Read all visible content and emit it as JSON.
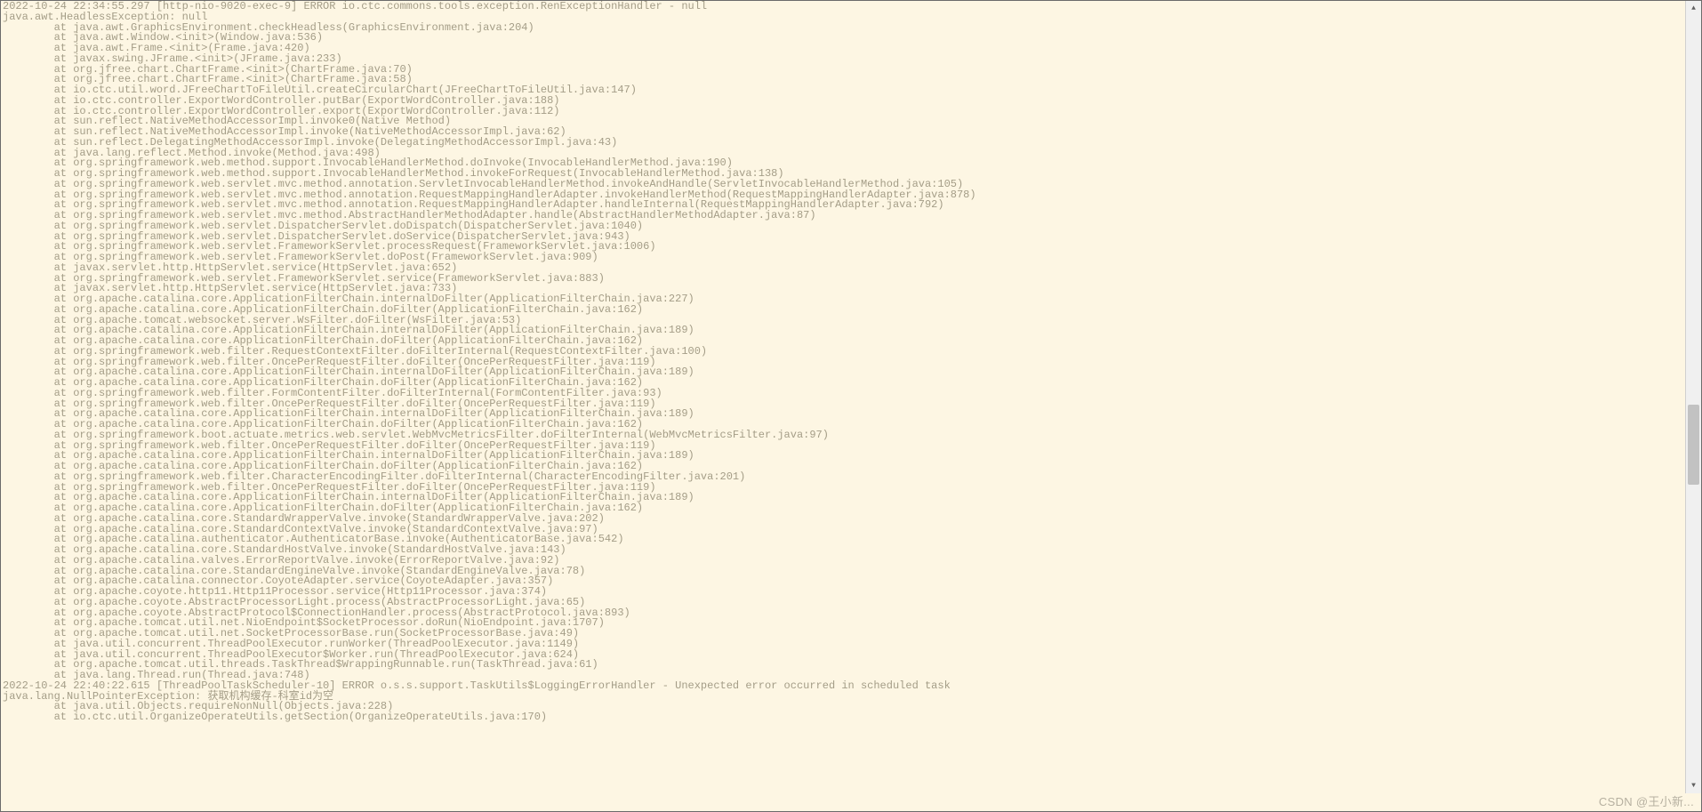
{
  "watermark": "CSDN @王小新...",
  "indent1": "        ",
  "lines": [
    "2022-10-24 22:34:55.297 [http-nio-9020-exec-9] ERROR io.ctc.commons.tools.exception.RenExceptionHandler - null",
    "java.awt.HeadlessException: null",
    "at java.awt.GraphicsEnvironment.checkHeadless(GraphicsEnvironment.java:204)",
    "at java.awt.Window.<init>(Window.java:536)",
    "at java.awt.Frame.<init>(Frame.java:420)",
    "at javax.swing.JFrame.<init>(JFrame.java:233)",
    "at org.jfree.chart.ChartFrame.<init>(ChartFrame.java:70)",
    "at org.jfree.chart.ChartFrame.<init>(ChartFrame.java:58)",
    "at io.ctc.util.word.JFreeChartToFileUtil.createCircularChart(JFreeChartToFileUtil.java:147)",
    "at io.ctc.controller.ExportWordController.putBar(ExportWordController.java:188)",
    "at io.ctc.controller.ExportWordController.export(ExportWordController.java:112)",
    "at sun.reflect.NativeMethodAccessorImpl.invoke0(Native Method)",
    "at sun.reflect.NativeMethodAccessorImpl.invoke(NativeMethodAccessorImpl.java:62)",
    "at sun.reflect.DelegatingMethodAccessorImpl.invoke(DelegatingMethodAccessorImpl.java:43)",
    "at java.lang.reflect.Method.invoke(Method.java:498)",
    "at org.springframework.web.method.support.InvocableHandlerMethod.doInvoke(InvocableHandlerMethod.java:190)",
    "at org.springframework.web.method.support.InvocableHandlerMethod.invokeForRequest(InvocableHandlerMethod.java:138)",
    "at org.springframework.web.servlet.mvc.method.annotation.ServletInvocableHandlerMethod.invokeAndHandle(ServletInvocableHandlerMethod.java:105)",
    "at org.springframework.web.servlet.mvc.method.annotation.RequestMappingHandlerAdapter.invokeHandlerMethod(RequestMappingHandlerAdapter.java:878)",
    "at org.springframework.web.servlet.mvc.method.annotation.RequestMappingHandlerAdapter.handleInternal(RequestMappingHandlerAdapter.java:792)",
    "at org.springframework.web.servlet.mvc.method.AbstractHandlerMethodAdapter.handle(AbstractHandlerMethodAdapter.java:87)",
    "at org.springframework.web.servlet.DispatcherServlet.doDispatch(DispatcherServlet.java:1040)",
    "at org.springframework.web.servlet.DispatcherServlet.doService(DispatcherServlet.java:943)",
    "at org.springframework.web.servlet.FrameworkServlet.processRequest(FrameworkServlet.java:1006)",
    "at org.springframework.web.servlet.FrameworkServlet.doPost(FrameworkServlet.java:909)",
    "at javax.servlet.http.HttpServlet.service(HttpServlet.java:652)",
    "at org.springframework.web.servlet.FrameworkServlet.service(FrameworkServlet.java:883)",
    "at javax.servlet.http.HttpServlet.service(HttpServlet.java:733)",
    "at org.apache.catalina.core.ApplicationFilterChain.internalDoFilter(ApplicationFilterChain.java:227)",
    "at org.apache.catalina.core.ApplicationFilterChain.doFilter(ApplicationFilterChain.java:162)",
    "at org.apache.tomcat.websocket.server.WsFilter.doFilter(WsFilter.java:53)",
    "at org.apache.catalina.core.ApplicationFilterChain.internalDoFilter(ApplicationFilterChain.java:189)",
    "at org.apache.catalina.core.ApplicationFilterChain.doFilter(ApplicationFilterChain.java:162)",
    "at org.springframework.web.filter.RequestContextFilter.doFilterInternal(RequestContextFilter.java:100)",
    "at org.springframework.web.filter.OncePerRequestFilter.doFilter(OncePerRequestFilter.java:119)",
    "at org.apache.catalina.core.ApplicationFilterChain.internalDoFilter(ApplicationFilterChain.java:189)",
    "at org.apache.catalina.core.ApplicationFilterChain.doFilter(ApplicationFilterChain.java:162)",
    "at org.springframework.web.filter.FormContentFilter.doFilterInternal(FormContentFilter.java:93)",
    "at org.springframework.web.filter.OncePerRequestFilter.doFilter(OncePerRequestFilter.java:119)",
    "at org.apache.catalina.core.ApplicationFilterChain.internalDoFilter(ApplicationFilterChain.java:189)",
    "at org.apache.catalina.core.ApplicationFilterChain.doFilter(ApplicationFilterChain.java:162)",
    "at org.springframework.boot.actuate.metrics.web.servlet.WebMvcMetricsFilter.doFilterInternal(WebMvcMetricsFilter.java:97)",
    "at org.springframework.web.filter.OncePerRequestFilter.doFilter(OncePerRequestFilter.java:119)",
    "at org.apache.catalina.core.ApplicationFilterChain.internalDoFilter(ApplicationFilterChain.java:189)",
    "at org.apache.catalina.core.ApplicationFilterChain.doFilter(ApplicationFilterChain.java:162)",
    "at org.springframework.web.filter.CharacterEncodingFilter.doFilterInternal(CharacterEncodingFilter.java:201)",
    "at org.springframework.web.filter.OncePerRequestFilter.doFilter(OncePerRequestFilter.java:119)",
    "at org.apache.catalina.core.ApplicationFilterChain.internalDoFilter(ApplicationFilterChain.java:189)",
    "at org.apache.catalina.core.ApplicationFilterChain.doFilter(ApplicationFilterChain.java:162)",
    "at org.apache.catalina.core.StandardWrapperValve.invoke(StandardWrapperValve.java:202)",
    "at org.apache.catalina.core.StandardContextValve.invoke(StandardContextValve.java:97)",
    "at org.apache.catalina.authenticator.AuthenticatorBase.invoke(AuthenticatorBase.java:542)",
    "at org.apache.catalina.core.StandardHostValve.invoke(StandardHostValve.java:143)",
    "at org.apache.catalina.valves.ErrorReportValve.invoke(ErrorReportValve.java:92)",
    "at org.apache.catalina.core.StandardEngineValve.invoke(StandardEngineValve.java:78)",
    "at org.apache.catalina.connector.CoyoteAdapter.service(CoyoteAdapter.java:357)",
    "at org.apache.coyote.http11.Http11Processor.service(Http11Processor.java:374)",
    "at org.apache.coyote.AbstractProcessorLight.process(AbstractProcessorLight.java:65)",
    "at org.apache.coyote.AbstractProtocol$ConnectionHandler.process(AbstractProtocol.java:893)",
    "at org.apache.tomcat.util.net.NioEndpoint$SocketProcessor.doRun(NioEndpoint.java:1707)",
    "at org.apache.tomcat.util.net.SocketProcessorBase.run(SocketProcessorBase.java:49)",
    "at java.util.concurrent.ThreadPoolExecutor.runWorker(ThreadPoolExecutor.java:1149)",
    "at java.util.concurrent.ThreadPoolExecutor$Worker.run(ThreadPoolExecutor.java:624)",
    "at org.apache.tomcat.util.threads.TaskThread$WrappingRunnable.run(TaskThread.java:61)",
    "at java.lang.Thread.run(Thread.java:748)",
    "2022-10-24 22:40:22.615 [ThreadPoolTaskScheduler-10] ERROR o.s.s.support.TaskUtils$LoggingErrorHandler - Unexpected error occurred in scheduled task",
    "java.lang.NullPointerException: 获取机构缓存-科室id为空",
    "at java.util.Objects.requireNonNull(Objects.java:228)",
    "at io.ctc.util.OrganizeOperateUtils.getSection(OrganizeOperateUtils.java:170)"
  ],
  "indentFlags": [
    0,
    0,
    1,
    1,
    1,
    1,
    1,
    1,
    1,
    1,
    1,
    1,
    1,
    1,
    1,
    1,
    1,
    1,
    1,
    1,
    1,
    1,
    1,
    1,
    1,
    1,
    1,
    1,
    1,
    1,
    1,
    1,
    1,
    1,
    1,
    1,
    1,
    1,
    1,
    1,
    1,
    1,
    1,
    1,
    1,
    1,
    1,
    1,
    1,
    1,
    1,
    1,
    1,
    1,
    1,
    1,
    1,
    1,
    1,
    1,
    1,
    1,
    1,
    1,
    1,
    0,
    0,
    1,
    1
  ]
}
